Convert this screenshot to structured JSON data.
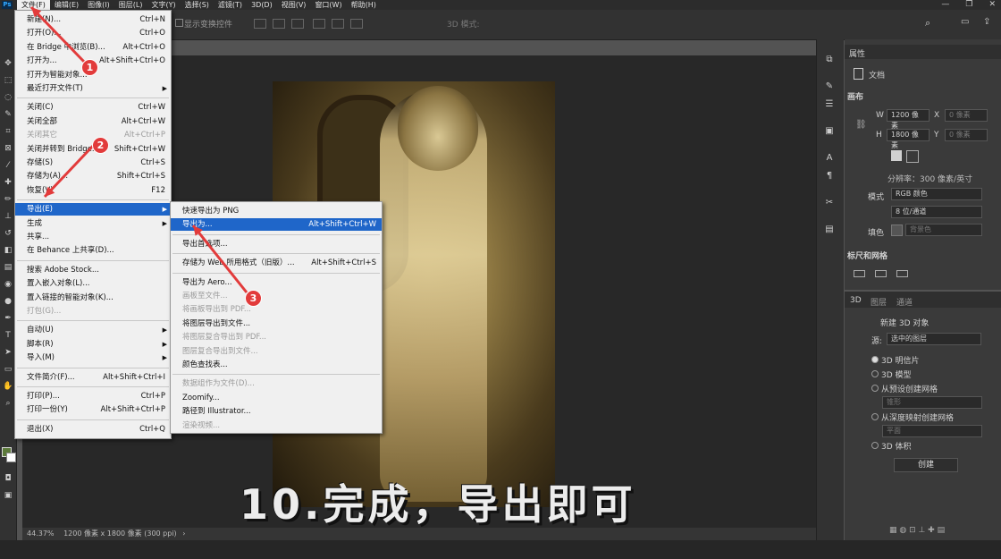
{
  "menubar": {
    "logo": "Ps",
    "items": [
      "文件(F)",
      "编辑(E)",
      "图像(I)",
      "图层(L)",
      "文字(Y)",
      "选择(S)",
      "滤镜(T)",
      "3D(D)",
      "视图(V)",
      "窗口(W)",
      "帮助(H)"
    ],
    "active_index": 0
  },
  "window_controls": {
    "minimize": "—",
    "restore": "❐",
    "close": "✕"
  },
  "options_bar": {
    "show_transform_label": "显示变换控件",
    "mode_3d_label": "3D 模式:"
  },
  "file_menu": {
    "items": [
      {
        "label": "新建(N)...",
        "shortcut": "Ctrl+N"
      },
      {
        "label": "打开(O)...",
        "shortcut": "Ctrl+O"
      },
      {
        "label": "在 Bridge 中浏览(B)...",
        "shortcut": "Alt+Ctrl+O"
      },
      {
        "label": "打开为...",
        "shortcut": "Alt+Shift+Ctrl+O"
      },
      {
        "label": "打开为智能对象...",
        "shortcut": ""
      },
      {
        "label": "最近打开文件(T)",
        "shortcut": "",
        "submenu": true
      },
      {
        "label": "关闭(C)",
        "shortcut": "Ctrl+W"
      },
      {
        "label": "关闭全部",
        "shortcut": "Alt+Ctrl+W"
      },
      {
        "label": "关闭其它",
        "shortcut": "Alt+Ctrl+P",
        "disabled": true
      },
      {
        "label": "关闭并转到 Bridge...",
        "shortcut": "Shift+Ctrl+W"
      },
      {
        "label": "存储(S)",
        "shortcut": "Ctrl+S"
      },
      {
        "label": "存储为(A)...",
        "shortcut": "Shift+Ctrl+S"
      },
      {
        "label": "恢复(V)",
        "shortcut": "F12"
      },
      {
        "label": "导出(E)",
        "shortcut": "",
        "submenu": true,
        "selected": true
      },
      {
        "label": "生成",
        "shortcut": "",
        "submenu": true
      },
      {
        "label": "共享...",
        "shortcut": ""
      },
      {
        "label": "在 Behance 上共享(D)...",
        "shortcut": ""
      },
      {
        "label": "搜索 Adobe Stock...",
        "shortcut": ""
      },
      {
        "label": "置入嵌入对象(L)...",
        "shortcut": ""
      },
      {
        "label": "置入链接的智能对象(K)...",
        "shortcut": ""
      },
      {
        "label": "打包(G)...",
        "shortcut": "",
        "disabled": true
      },
      {
        "label": "自动(U)",
        "shortcut": "",
        "submenu": true
      },
      {
        "label": "脚本(R)",
        "shortcut": "",
        "submenu": true
      },
      {
        "label": "导入(M)",
        "shortcut": "",
        "submenu": true
      },
      {
        "label": "文件简介(F)...",
        "shortcut": "Alt+Shift+Ctrl+I"
      },
      {
        "label": "打印(P)...",
        "shortcut": "Ctrl+P"
      },
      {
        "label": "打印一份(Y)",
        "shortcut": "Alt+Shift+Ctrl+P"
      },
      {
        "label": "退出(X)",
        "shortcut": "Ctrl+Q"
      }
    ]
  },
  "export_menu": {
    "items": [
      {
        "label": "快速导出为 PNG",
        "shortcut": ""
      },
      {
        "label": "导出为...",
        "shortcut": "Alt+Shift+Ctrl+W",
        "selected": true
      },
      {
        "label": "导出首选项...",
        "shortcut": ""
      },
      {
        "label": "存储为 Web 所用格式（旧版）...",
        "shortcut": "Alt+Shift+Ctrl+S"
      },
      {
        "label": "导出为 Aero...",
        "shortcut": ""
      },
      {
        "label": "画板至文件...",
        "shortcut": "",
        "disabled": true
      },
      {
        "label": "将画板导出到 PDF...",
        "shortcut": "",
        "disabled": true
      },
      {
        "label": "将图层导出到文件...",
        "shortcut": ""
      },
      {
        "label": "将图层复合导出到 PDF...",
        "shortcut": "",
        "disabled": true
      },
      {
        "label": "图层复合导出到文件...",
        "shortcut": "",
        "disabled": true
      },
      {
        "label": "颜色查找表...",
        "shortcut": ""
      },
      {
        "label": "数据组作为文件(D)...",
        "shortcut": "",
        "disabled": true
      },
      {
        "label": "Zoomify...",
        "shortcut": ""
      },
      {
        "label": "路径到 Illustrator...",
        "shortcut": ""
      },
      {
        "label": "渲染视频...",
        "shortcut": "",
        "disabled": true
      }
    ]
  },
  "annotations": {
    "step1": "1",
    "step2": "2",
    "step3": "3",
    "color": "#e23b3b"
  },
  "caption": "10.完成，导出即可",
  "status_bar": {
    "zoom": "44.37%",
    "doc_info": "1200 像素 x 1800 像素 (300 ppi)",
    "arrow": "›"
  },
  "properties": {
    "tab": "属性",
    "doc_label": "文档",
    "canvas_section": "画布",
    "w_label": "W",
    "w_value": "1200 像素",
    "h_label": "H",
    "h_value": "1800 像素",
    "x_label": "X",
    "x_value": "0 像素",
    "y_label": "Y",
    "y_value": "0 像素",
    "resolution": "分辨率：300 像素/英寸",
    "mode_label": "模式",
    "mode_value": "RGB 颜色",
    "depth_value": "8 位/通道",
    "fill_label": "填色",
    "fill_value": "背景色",
    "rulers_section": "标尺和网格"
  },
  "panel3d": {
    "tabs": [
      "3D",
      "图层",
      "通道"
    ],
    "new_object_label": "新建 3D 对象",
    "source_label": "源:",
    "source_value": "选中的图层",
    "options": [
      "3D 明信片",
      "3D 模型",
      "从预设创建网格",
      "从深度映射创建网格",
      "3D 体积"
    ],
    "selected_option": 0,
    "preset_field": "锥形",
    "depth_field": "平面",
    "create_button": "创建"
  }
}
